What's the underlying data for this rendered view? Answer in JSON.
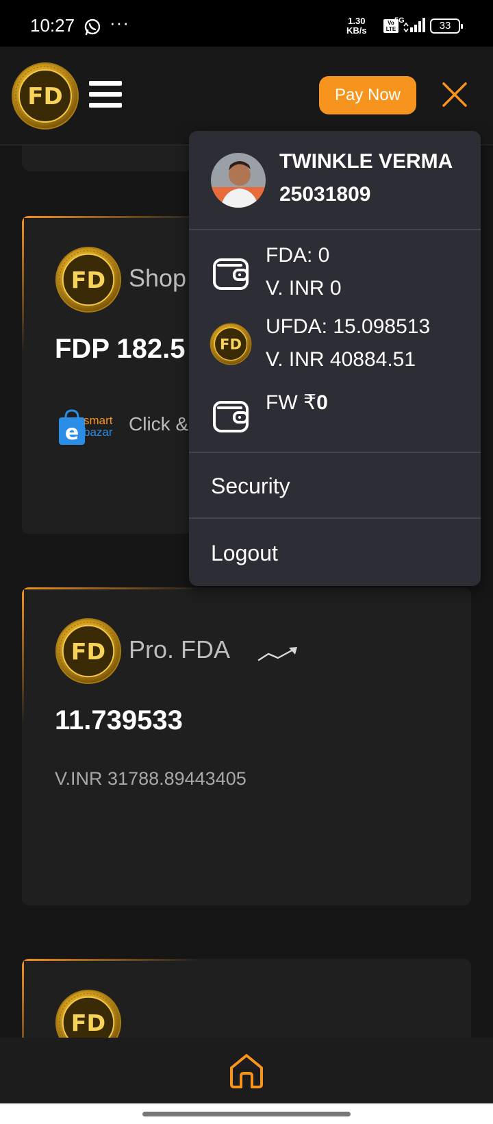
{
  "status_bar": {
    "time": "10:27",
    "dots": "···",
    "speed_value": "1.30",
    "speed_unit": "KB/s",
    "volte": "Vo LTE",
    "network": "5G",
    "battery": "33"
  },
  "header": {
    "logo_text": "FD",
    "pay_now_label": "Pay Now",
    "accent_color": "#f7941d"
  },
  "cards": [
    {
      "title": "Shop",
      "value": "FDP 182.5",
      "sub_brand_top": "smart",
      "sub_brand_bottom": "bazar",
      "sub_text": "Click &"
    },
    {
      "title": "Pro. FDA",
      "value": "11.739533",
      "sub_text": "V.INR 31788.89443405",
      "trend_icon": "trending-up-icon"
    }
  ],
  "dropdown": {
    "user_name": "TWINKLE VERMA",
    "user_id": "25031809",
    "wallets": [
      {
        "icon": "wallet-icon",
        "line1": "FDA: 0",
        "line2": "V. INR 0"
      },
      {
        "icon": "fd-coin-icon",
        "line1": "UFDA: 15.098513",
        "line2": "V. INR 40884.51"
      },
      {
        "icon": "wallet-icon",
        "line1_prefix": "FW ₹",
        "line1_value": "0"
      }
    ],
    "menu": [
      {
        "label": "Security"
      },
      {
        "label": "Logout"
      }
    ]
  },
  "bottom_nav": {
    "home_icon": "home-icon"
  }
}
